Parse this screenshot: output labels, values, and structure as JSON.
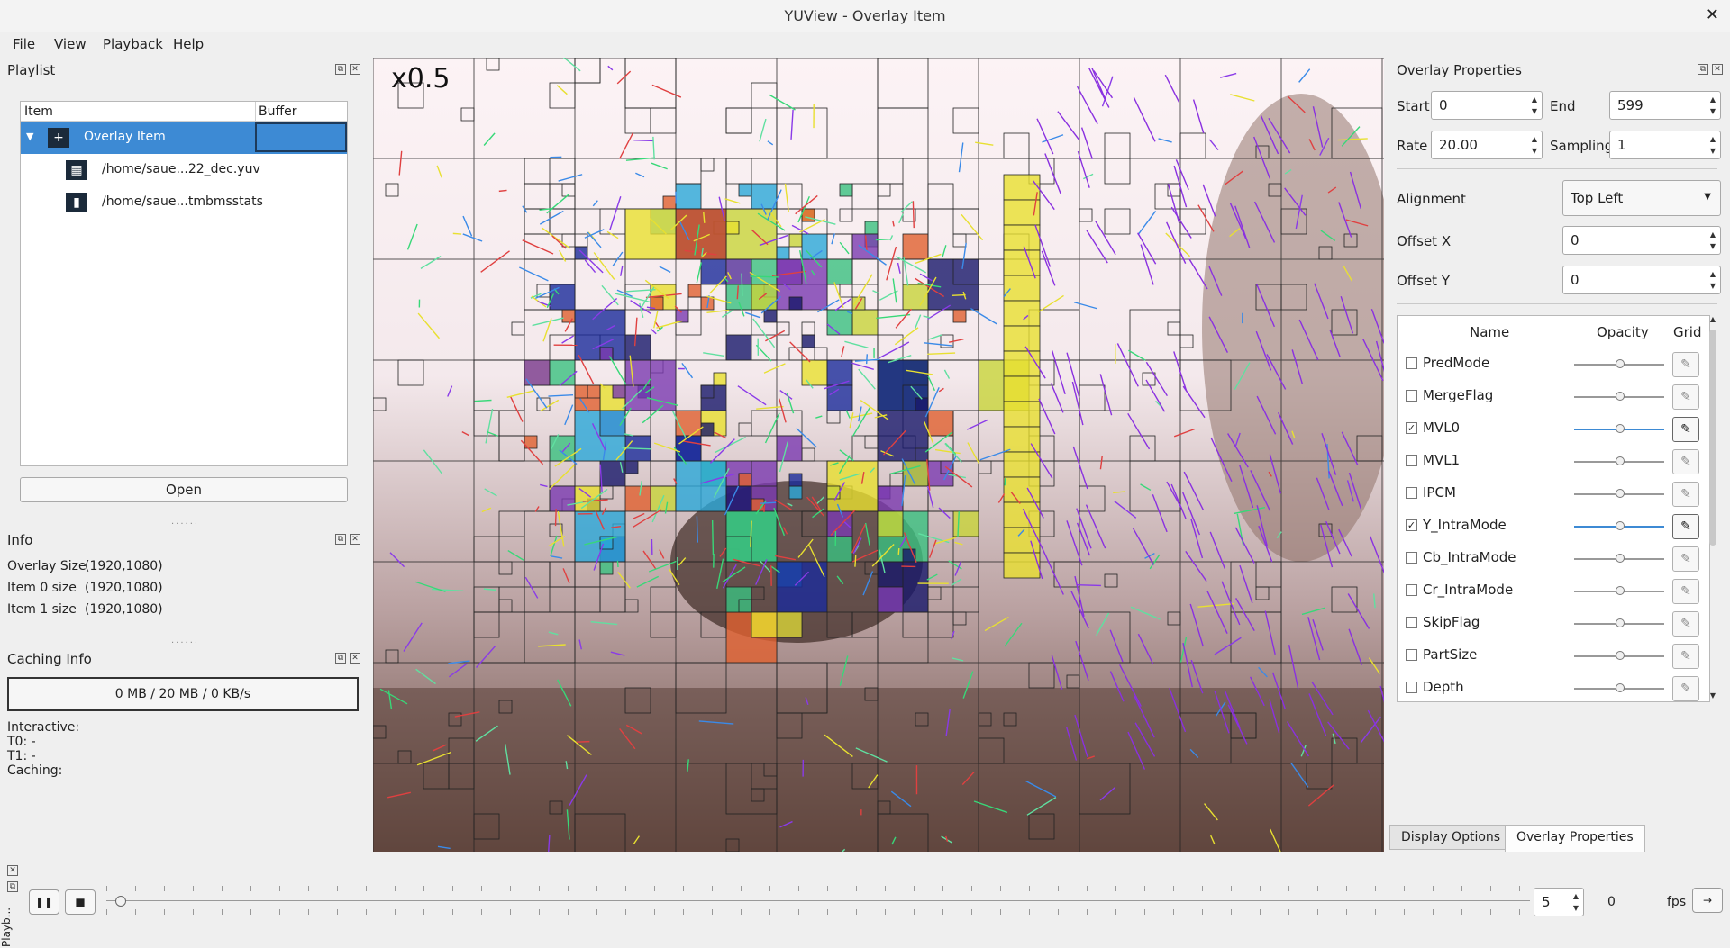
{
  "window": {
    "title": "YUView - Overlay Item"
  },
  "menu": [
    "File",
    "View",
    "Playback",
    "Help"
  ],
  "playlist": {
    "title": "Playlist",
    "columns": [
      "Item",
      "Buffer"
    ],
    "items": [
      {
        "label": "Overlay Item",
        "icon": "overlay-icon"
      },
      {
        "label": "/home/saue...22_dec.yuv",
        "icon": "video-clapper-icon"
      },
      {
        "label": "/home/saue...tmbmsstats",
        "icon": "bar-chart-icon"
      }
    ],
    "open_button": "Open"
  },
  "info": {
    "title": "Info",
    "rows": [
      {
        "label": "Overlay Size",
        "value": "(1920,1080)"
      },
      {
        "label": "Item 0 size",
        "value": "(1920,1080)"
      },
      {
        "label": "Item 1 size",
        "value": "(1920,1080)"
      }
    ]
  },
  "caching": {
    "title": "Caching Info",
    "status": "0 MB / 20 MB / 0 KB/s",
    "lines": [
      "Interactive:",
      "T0: -",
      "T1: -",
      "Caching:"
    ]
  },
  "viewer": {
    "zoom": "x0.5"
  },
  "overlay_properties": {
    "title": "Overlay Properties",
    "start_label": "Start",
    "start": "0",
    "end_label": "End",
    "end": "599",
    "rate_label": "Rate",
    "rate": "20.00",
    "sampling_label": "Sampling",
    "sampling": "1",
    "alignment_label": "Alignment",
    "alignment": "Top Left",
    "offset_x_label": "Offset X",
    "offset_x": "0",
    "offset_y_label": "Offset Y",
    "offset_y": "0"
  },
  "layers": {
    "columns": [
      "Name",
      "Opacity",
      "Grid"
    ],
    "rows": [
      {
        "name": "PredMode",
        "checked": false,
        "grid": false
      },
      {
        "name": "MergeFlag",
        "checked": false,
        "grid": false
      },
      {
        "name": "MVL0",
        "checked": true,
        "grid": true
      },
      {
        "name": "MVL1",
        "checked": false,
        "grid": false
      },
      {
        "name": "IPCM",
        "checked": false,
        "grid": false
      },
      {
        "name": "Y_IntraMode",
        "checked": true,
        "grid": true
      },
      {
        "name": "Cb_IntraMode",
        "checked": false,
        "grid": false
      },
      {
        "name": "Cr_IntraMode",
        "checked": false,
        "grid": false
      },
      {
        "name": "SkipFlag",
        "checked": false,
        "grid": false
      },
      {
        "name": "PartSize",
        "checked": false,
        "grid": false
      },
      {
        "name": "Depth",
        "checked": false,
        "grid": false
      }
    ]
  },
  "tabs": [
    "Display Options",
    "Overlay Properties"
  ],
  "playback": {
    "dock_label": "Playb...",
    "frame": "5",
    "frame_count": "0",
    "fps_label": "fps",
    "position": 0.0
  },
  "colors": {
    "accent": "#3d8ad4"
  }
}
